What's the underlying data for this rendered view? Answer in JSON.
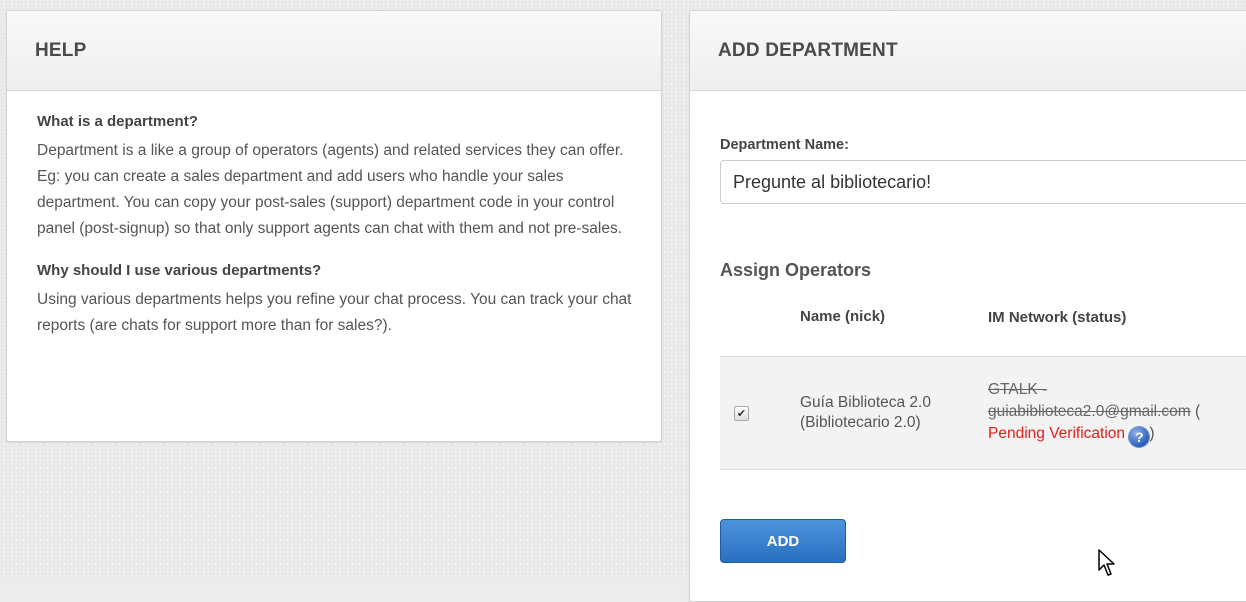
{
  "help": {
    "title": "HELP",
    "q1": "What is a department?",
    "a1": "Department is a like a group of operators (agents) and related services they can offer. Eg: you can create a sales department and add users who handle your sales department. You can copy your post-sales (support) department code in your control panel (post-signup) so that only support agents can chat with them and not pre-sales.",
    "q2": "Why should I use various departments?",
    "a2": "Using various departments helps you refine your chat process. You can track your chat reports (are chats for support more than for sales?)."
  },
  "add_department": {
    "title": "ADD DEPARTMENT",
    "name_label": "Department Name:",
    "name_value": "Pregunte al bibliotecario!",
    "assign_title": "Assign Operators",
    "table": {
      "headers": [
        "",
        "Name (nick)",
        "IM Network (status)"
      ],
      "rows": [
        {
          "checked": true,
          "name": "Guía Biblioteca 2.0",
          "nick": "(Bibliotecario 2.0)",
          "im_network": "GTALK -",
          "im_address": "guiabiblioteca2.0@gmail.com",
          "open_paren": "(",
          "status": "Pending Verification",
          "close_paren": ")"
        }
      ]
    },
    "add_button": "ADD"
  },
  "colors": {
    "pending": "#e0201b",
    "button": "#2a6fc0"
  },
  "icons": {
    "help_icon": "question-circle-icon",
    "cursor": "mouse-pointer-icon"
  }
}
